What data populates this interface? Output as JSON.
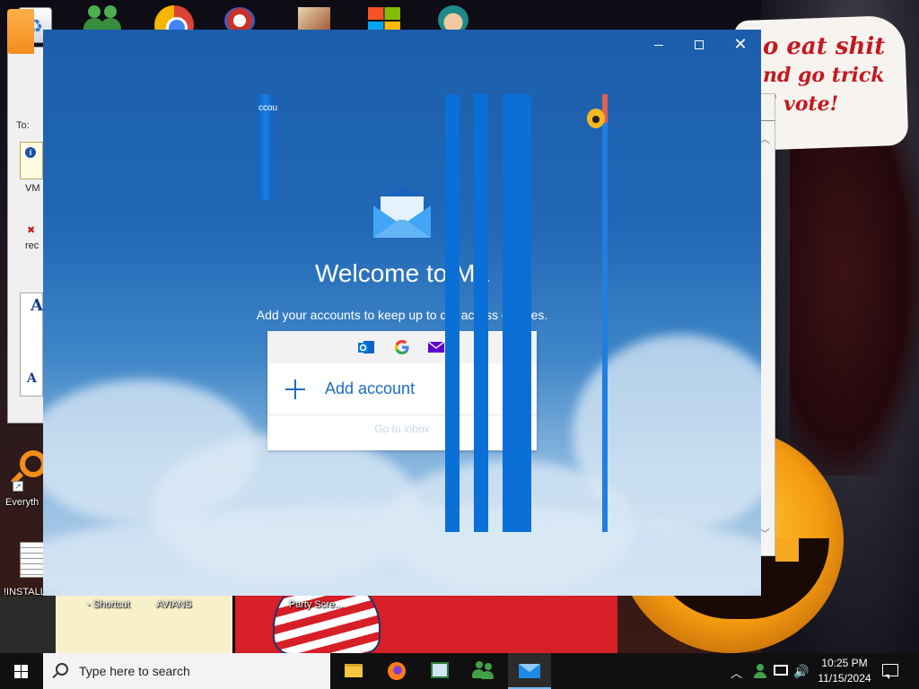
{
  "wallpaper": {
    "bubble_line1": "o eat shit",
    "bubble_line2": "nd go trick",
    "bubble_line3": "d vote!"
  },
  "desktop_icons": {
    "everything_label": "Everyth",
    "install_label": "!INSTALL",
    "shortcut_label": "- Shortcut",
    "avians_label": "AVIANS",
    "party_label": "Party Scre..."
  },
  "background_app": {
    "to_label": "To:",
    "vm_text": "VM",
    "rec_text": "rec",
    "a_glyph": "A"
  },
  "mail_window": {
    "welcome_title": "Welcome to Ma",
    "welcome_subtitle": "Add your accounts to keep up to d     e across devices.",
    "add_account_label": "Add account",
    "goto_inbox_label": "Go to inbox",
    "glitch_text": "ccou",
    "providers": [
      "outlook-icon",
      "google-icon",
      "yahoo-icon"
    ],
    "accent_color": "#1a6cc2"
  },
  "taskbar": {
    "search_placeholder": "Type here to search",
    "time": "10:25 PM",
    "date": "11/15/2024",
    "apps": [
      "file-explorer",
      "firefox",
      "document-app",
      "users-app",
      "mail"
    ],
    "active_app": "mail"
  }
}
